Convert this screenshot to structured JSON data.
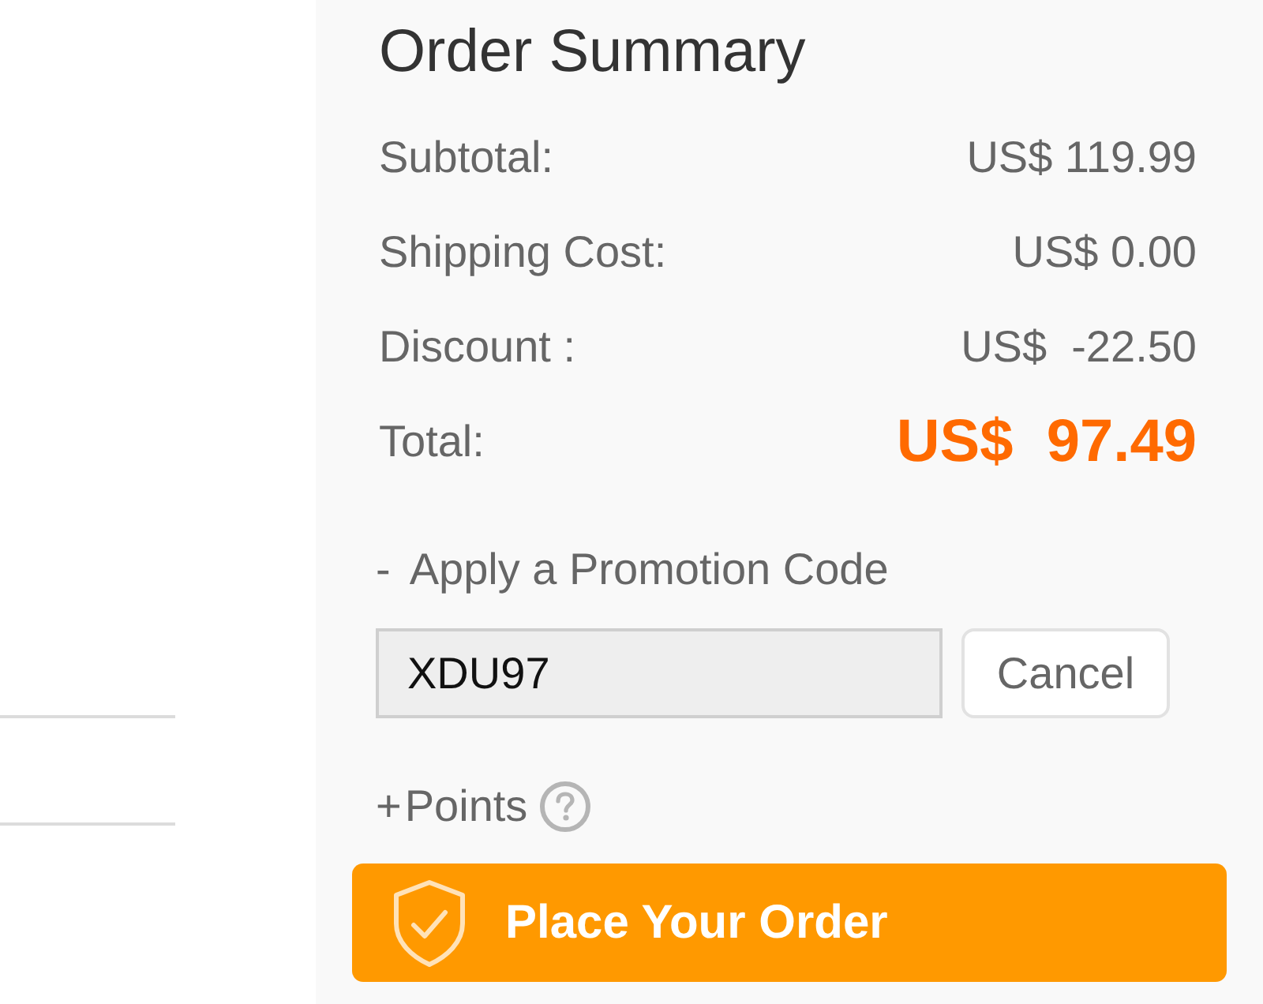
{
  "order_summary": {
    "title": "Order Summary",
    "rows": [
      {
        "kind": "line",
        "label": "Subtotal:",
        "value": "US$ 119.99"
      },
      {
        "kind": "line",
        "label": "Shipping Cost:",
        "value": "US$ 0.00"
      },
      {
        "kind": "line",
        "label": "Discount :",
        "value": "US$  -22.50"
      },
      {
        "kind": "total",
        "label": "Total:",
        "value": "US$  97.49"
      }
    ]
  },
  "promotion": {
    "toggle": "-",
    "label": "Apply a Promotion Code",
    "code_value": "XDU97",
    "cancel_button": "Cancel"
  },
  "points": {
    "toggle": "+",
    "label": "Points"
  },
  "place_order_button": "Place Your Order"
}
